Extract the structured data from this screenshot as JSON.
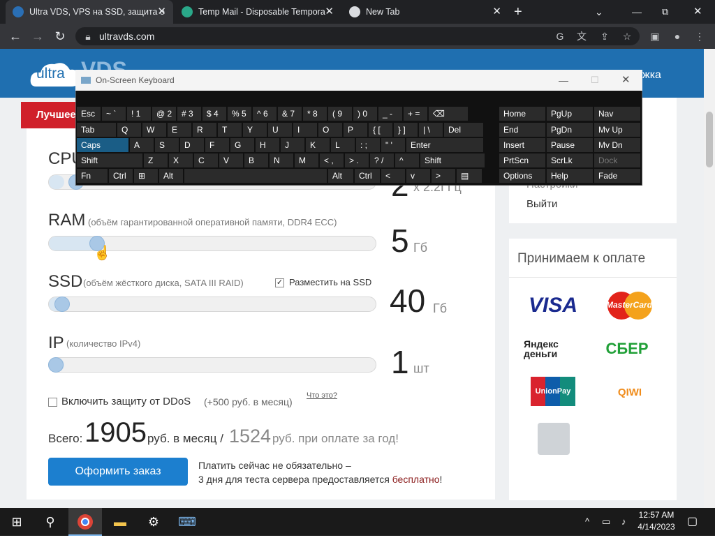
{
  "browser": {
    "tabs": [
      {
        "title": "Ultra VDS, VPS на SSD, защита о",
        "active": true
      },
      {
        "title": "Temp Mail - Disposable Tempora",
        "active": false
      },
      {
        "title": "New Tab",
        "active": false
      }
    ],
    "new_tab_symbol": "+",
    "url": "ultravds.com",
    "window_controls": {
      "minimize": "⌄",
      "restore": "⧉",
      "close": "✕"
    }
  },
  "site": {
    "logo_ultra": "ultra",
    "logo_vds": "VDS",
    "nav_right_fragment": "жка",
    "ribbon": "Лучшее"
  },
  "osk": {
    "title": "On-Screen Keyboard",
    "rows": [
      [
        "Esc",
        "~ `",
        "! 1",
        "@ 2",
        "# 3",
        "$ 4",
        "% 5",
        "^ 6",
        "& 7",
        "* 8",
        "( 9",
        ") 0",
        "_ -",
        "+ =",
        "⌫"
      ],
      [
        "Tab",
        "Q",
        "W",
        "E",
        "R",
        "T",
        "Y",
        "U",
        "I",
        "O",
        "P",
        "{ [",
        "} ]",
        "| \\",
        "Del"
      ],
      [
        "Caps",
        "A",
        "S",
        "D",
        "F",
        "G",
        "H",
        "J",
        "K",
        "L",
        ": ;",
        "\" '",
        "Enter"
      ],
      [
        "Shift",
        "Z",
        "X",
        "C",
        "V",
        "B",
        "N",
        "M",
        "< ,",
        "> .",
        "? /",
        "^",
        "Shift"
      ],
      [
        "Fn",
        "Ctrl",
        "⊞",
        "Alt",
        "",
        "Alt",
        "Ctrl",
        "<",
        "v",
        ">",
        "▤"
      ]
    ],
    "nav": [
      [
        "Home",
        "PgUp",
        "Nav"
      ],
      [
        "End",
        "PgDn",
        "Mv Up"
      ],
      [
        "Insert",
        "Pause",
        "Mv Dn"
      ],
      [
        "PrtScn",
        "ScrLk",
        "Dock"
      ],
      [
        "Options",
        "Help",
        "Fade"
      ]
    ]
  },
  "config": {
    "cpu": {
      "label": "CPU",
      "value": "2",
      "unit": "x 2.2ГГц",
      "level": 0.04
    },
    "ram": {
      "label": "RAM",
      "sub": "(объём гарантированной оперативной памяти, DDR4 ECC)",
      "value": "5",
      "unit": "Гб",
      "level": 0.15
    },
    "ssd": {
      "label": "SSD",
      "sub": "(объём жёсткого диска, SATA III RAID)",
      "value": "40",
      "unit": "Гб",
      "level": 0.04,
      "ssd_checkbox": "Разместить на SSD",
      "ssd_checked": true
    },
    "ip": {
      "label": "IP",
      "sub": "(количество IPv4)",
      "value": "1",
      "unit": "шт",
      "level": 0.0
    },
    "ddos": {
      "label": "Включить защиту от DDoS",
      "price": "(+500 руб. в месяц)",
      "what": "Что это?",
      "checked": false
    },
    "total": {
      "prefix": "Всего:",
      "amount": "1905",
      "per_month": "руб. в месяц /",
      "year_amount": "1524",
      "year_text": "руб. при оплате за год!"
    },
    "order_button": "Оформить заказ",
    "note_line1": "Платить сейчас не обязательно –",
    "note_line2": "3 дня для теста сервера предоставляется ",
    "note_free": "бесплатно",
    "note_end": "!"
  },
  "sidebar": {
    "links": [
      "Настройки",
      "Выйти"
    ],
    "payments_title": "Принимаем к оплате",
    "payments": [
      "VISA",
      "MasterCard",
      "Яндекс деньги",
      "СБЕР",
      "UnionPay",
      "QIWI",
      "",
      ""
    ]
  },
  "taskbar": {
    "time": "12:57 AM",
    "date": "4/14/2023"
  }
}
